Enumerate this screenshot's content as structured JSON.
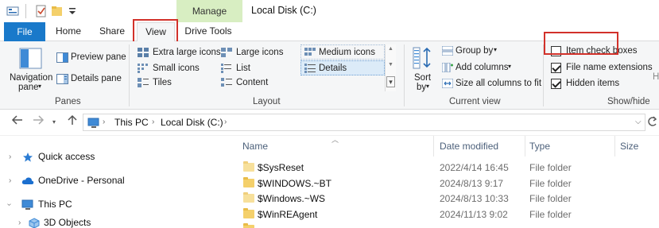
{
  "titlebar": {
    "manage_tab": "Manage",
    "window_title": "Local Disk (C:)",
    "quick_access_icons": [
      "properties-icon",
      "checkmark-doc-icon",
      "new-folder-icon",
      "customize-arrow-icon"
    ]
  },
  "tabs": [
    {
      "label": "File",
      "active": false
    },
    {
      "label": "Home",
      "active": false
    },
    {
      "label": "Share",
      "active": false
    },
    {
      "label": "View",
      "active": true
    },
    {
      "label": "Drive Tools",
      "active": false
    }
  ],
  "ribbon": {
    "panes": {
      "group_label": "Panes",
      "navigation_pane_line1": "Navigation",
      "navigation_pane_line2": "pane",
      "preview_pane": "Preview pane",
      "details_pane": "Details pane"
    },
    "layout": {
      "group_label": "Layout",
      "options": [
        "Extra large icons",
        "Large icons",
        "Medium icons",
        "Small icons",
        "List",
        "Details",
        "Tiles",
        "Content"
      ],
      "selected": "Details"
    },
    "current_view": {
      "group_label": "Current view",
      "sort_line1": "Sort",
      "sort_line2": "by",
      "group_by": "Group by",
      "add_columns": "Add columns",
      "size_all_columns": "Size all columns to fit"
    },
    "show_hide": {
      "group_label": "Show/hide",
      "item_check_boxes": {
        "label": "Item check boxes",
        "checked": false
      },
      "file_name_extensions": {
        "label": "File name extensions",
        "checked": true
      },
      "hidden_items": {
        "label": "Hidden items",
        "checked": true
      },
      "overflow": "H"
    }
  },
  "address": {
    "crumbs": [
      "This PC",
      "Local Disk (C:)"
    ]
  },
  "navpane": {
    "items": [
      {
        "label": "Quick access",
        "icon": "star-icon"
      },
      {
        "label": "OneDrive - Personal",
        "icon": "cloud-icon"
      },
      {
        "label": "This PC",
        "icon": "computer-icon"
      },
      {
        "label": "3D Objects",
        "icon": "cube-icon"
      }
    ]
  },
  "filelist": {
    "columns": [
      "Name",
      "Date modified",
      "Type",
      "Size"
    ],
    "rows": [
      {
        "name": "$SysReset",
        "date": "2022/4/14 16:45",
        "type": "File folder"
      },
      {
        "name": "$WINDOWS.~BT",
        "date": "2024/8/13 9:17",
        "type": "File folder"
      },
      {
        "name": "$Windows.~WS",
        "date": "2024/8/13 10:33",
        "type": "File folder"
      },
      {
        "name": "$WinREAgent",
        "date": "2024/11/13 9:02",
        "type": "File folder"
      }
    ]
  },
  "colors": {
    "file_tab": "#1979ca",
    "manage_tab": "#d8eec2",
    "highlight_box": "#d2312a",
    "ribbon_bg": "#f5f6f7"
  }
}
